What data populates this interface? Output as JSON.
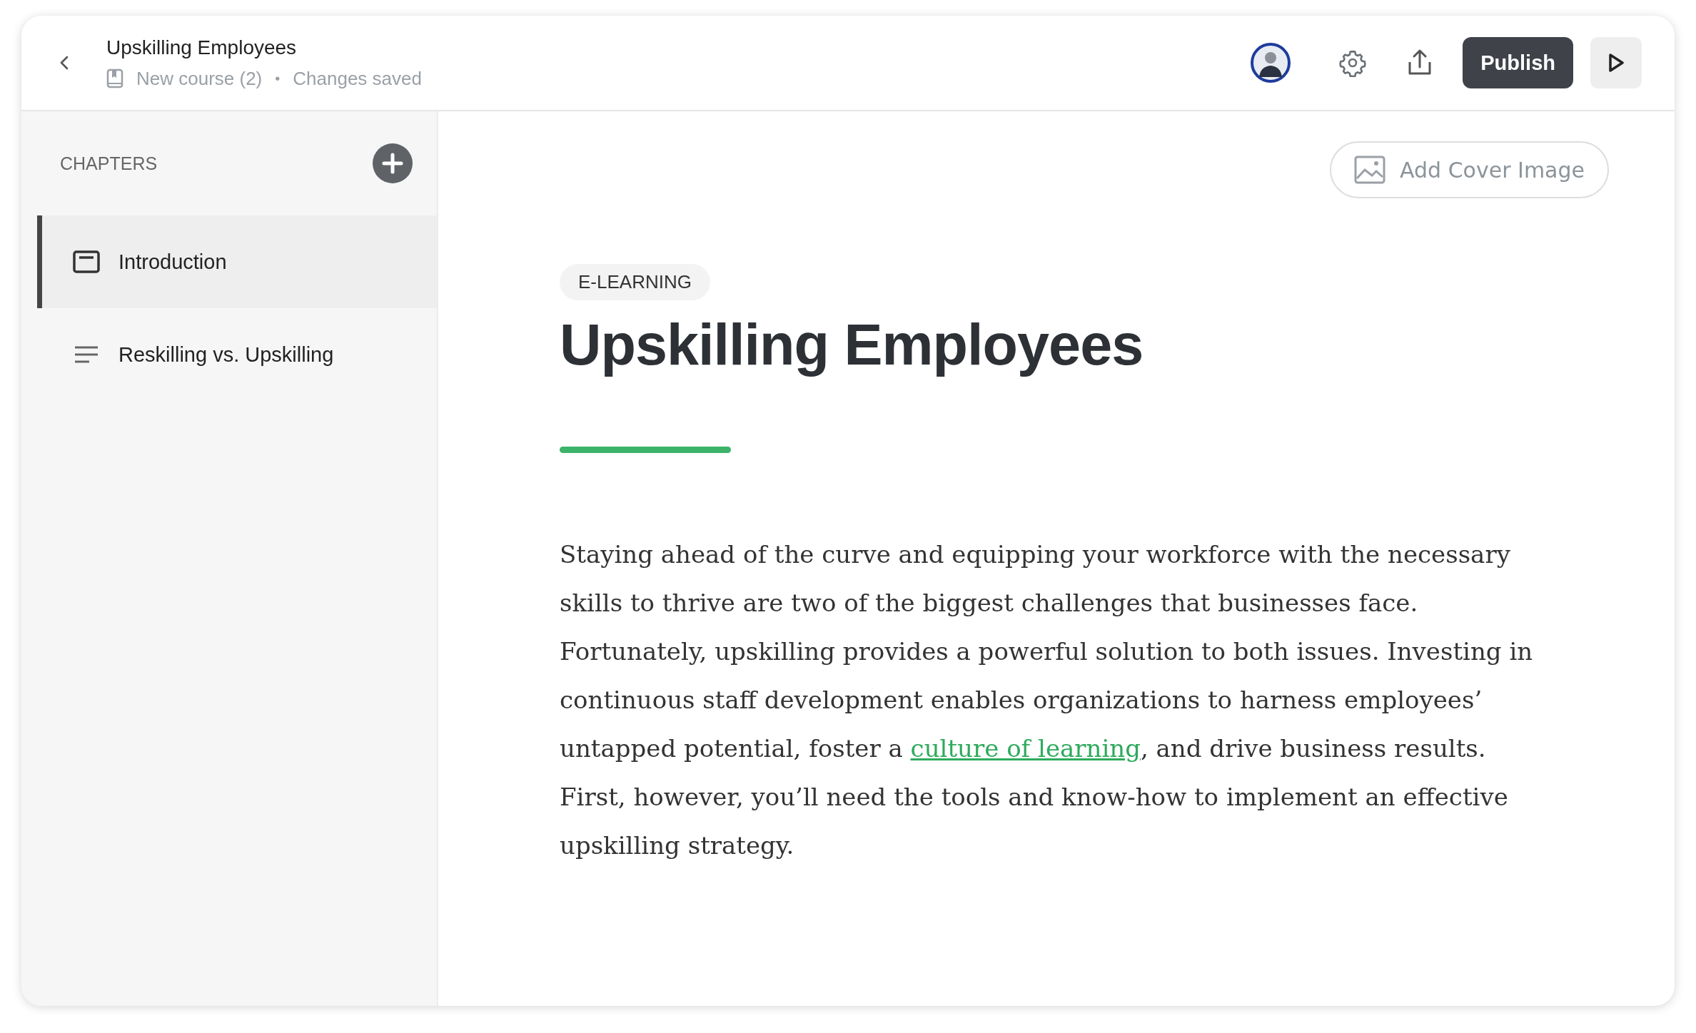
{
  "header": {
    "title": "Upskilling Employees",
    "course": "New course (2)",
    "separator": "•",
    "status": "Changes saved",
    "publish": "Publish"
  },
  "sidebar": {
    "heading": "CHAPTERS",
    "items": [
      {
        "label": "Introduction",
        "kind": "page",
        "selected": true
      },
      {
        "label": "Reskilling vs. Upskilling",
        "kind": "text",
        "selected": false
      }
    ]
  },
  "content": {
    "cover_button": "Add Cover Image",
    "tag": "E-LEARNING",
    "title": "Upskilling Employees",
    "body": {
      "before": "Staying ahead of the curve and equipping your workforce with the necessary skills to thrive are two of the biggest challenges that businesses face. Fortunately, upskilling provides a powerful solution to both issues. Investing in continuous staff development enables organizations to harness employees’ untapped potential, foster a ",
      "link": "culture of learning",
      "after": ", and drive business results. First, however, you’ll need the tools and know-how to implement an effective upskilling strategy."
    }
  }
}
